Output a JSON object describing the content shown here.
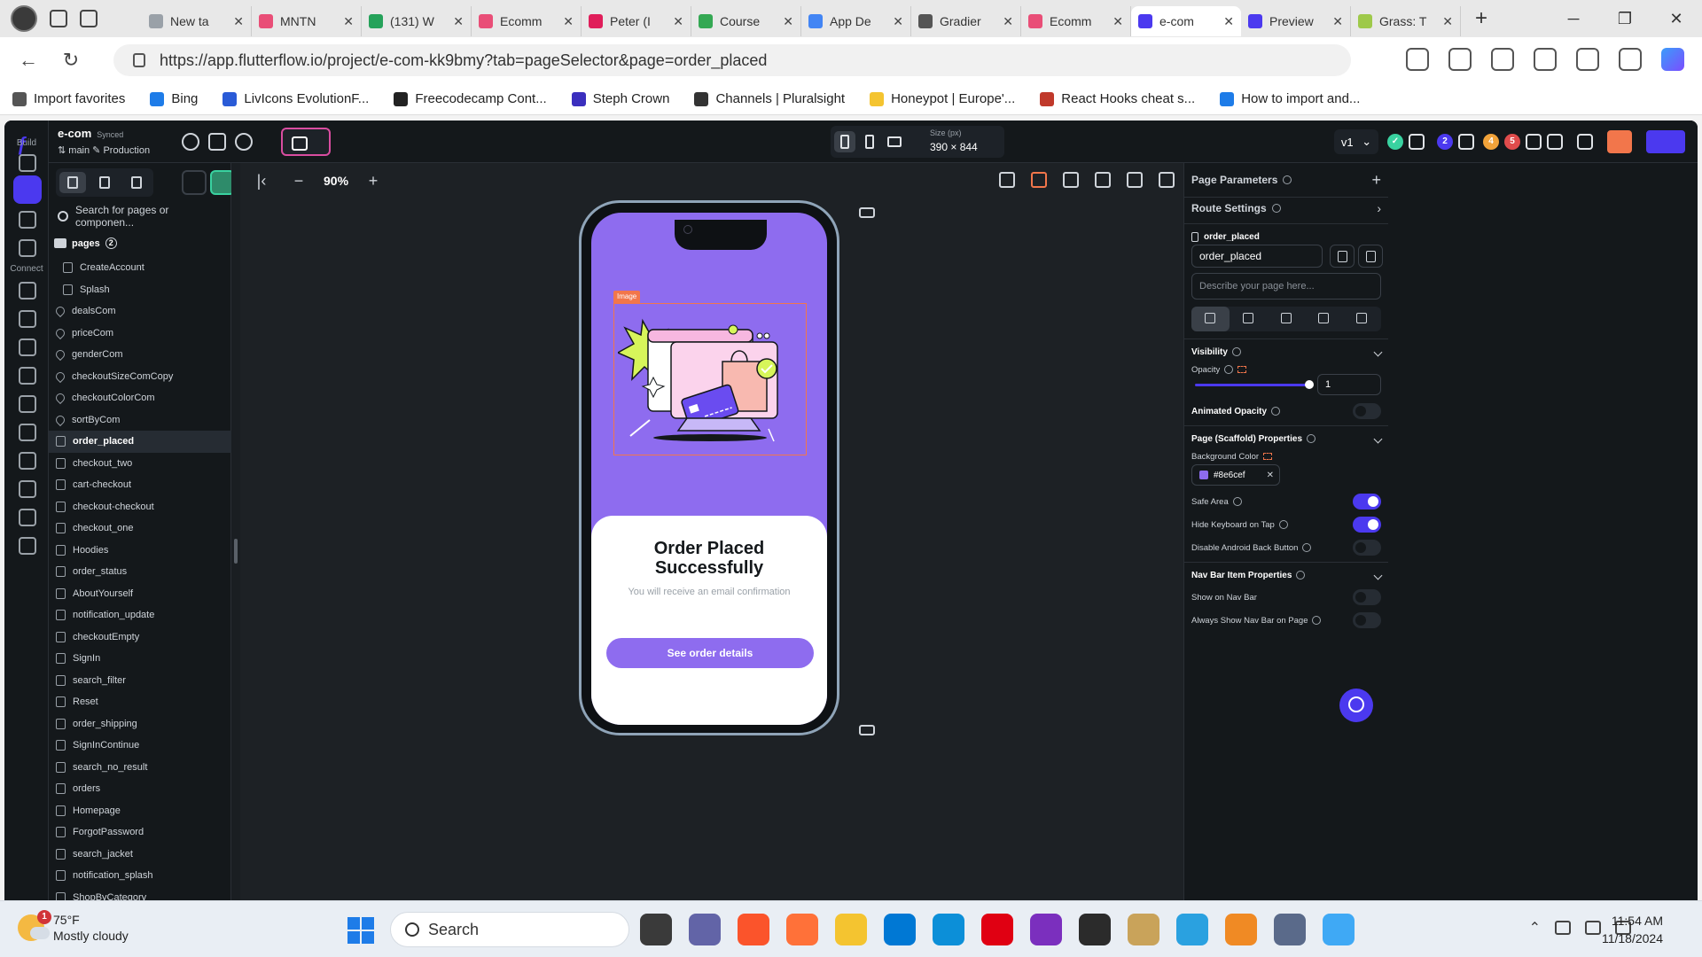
{
  "browser": {
    "tabs": [
      {
        "title": "New ta",
        "color": "#9aa1a8"
      },
      {
        "title": "MNTN",
        "color": "#e94e77"
      },
      {
        "title": "(131) W",
        "color": "#25a25a"
      },
      {
        "title": "Ecomm",
        "color": "#e94e77"
      },
      {
        "title": "Peter (I",
        "color": "#e01e5a"
      },
      {
        "title": "Course",
        "color": "#34a853"
      },
      {
        "title": "App De",
        "color": "#4285f4"
      },
      {
        "title": "Gradier",
        "color": "#555555"
      },
      {
        "title": "Ecomm",
        "color": "#e94e77"
      },
      {
        "title": "e-com",
        "color": "#4b39ef",
        "active": true
      },
      {
        "title": "Preview",
        "color": "#4b39ef"
      },
      {
        "title": "Grass: T",
        "color": "#9ec94a"
      }
    ],
    "url": "https://app.flutterflow.io/project/e-com-kk9bmy?tab=pageSelector&page=order_placed",
    "favorites": [
      "Import favorites",
      "Bing",
      "LivIcons EvolutionF...",
      "Freecodecamp Cont...",
      "Steph Crown",
      "Channels | Pluralsight",
      "Honeypot | Europe'...",
      "React Hooks cheat s...",
      "How to import and..."
    ]
  },
  "app": {
    "project_name": "e-com",
    "sync_status": "Synced",
    "branch": "main",
    "environment": "Production",
    "rail_sections": {
      "build": "Build",
      "connect": "Connect"
    },
    "device_size_label": "Size (px)",
    "device_size": "390 × 844",
    "version": "v1",
    "badge_counts": [
      "2",
      "4",
      "5"
    ],
    "zoom": "90%"
  },
  "pages": {
    "folder": "pages",
    "folder_count": "2",
    "items": [
      {
        "name": "CreateAccount",
        "icon": "page",
        "indent": true
      },
      {
        "name": "Splash",
        "icon": "page",
        "indent": true
      },
      {
        "name": "dealsCom",
        "icon": "component"
      },
      {
        "name": "priceCom",
        "icon": "component"
      },
      {
        "name": "genderCom",
        "icon": "component"
      },
      {
        "name": "checkoutSizeComCopy",
        "icon": "component"
      },
      {
        "name": "checkoutColorCom",
        "icon": "component"
      },
      {
        "name": "sortByCom",
        "icon": "component"
      },
      {
        "name": "order_placed",
        "icon": "page",
        "selected": true
      },
      {
        "name": "checkout_two",
        "icon": "page"
      },
      {
        "name": "cart-checkout",
        "icon": "page"
      },
      {
        "name": "checkout-checkout",
        "icon": "page"
      },
      {
        "name": "checkout_one",
        "icon": "page"
      },
      {
        "name": "Hoodies",
        "icon": "page"
      },
      {
        "name": "order_status",
        "icon": "page"
      },
      {
        "name": "AboutYourself",
        "icon": "page"
      },
      {
        "name": "notification_update",
        "icon": "page"
      },
      {
        "name": "checkoutEmpty",
        "icon": "page"
      },
      {
        "name": "SignIn",
        "icon": "page"
      },
      {
        "name": "search_filter",
        "icon": "page"
      },
      {
        "name": "Reset",
        "icon": "page"
      },
      {
        "name": "order_shipping",
        "icon": "page"
      },
      {
        "name": "SignInContinue",
        "icon": "page"
      },
      {
        "name": "search_no_result",
        "icon": "page"
      },
      {
        "name": "orders",
        "icon": "page"
      },
      {
        "name": "Homepage",
        "icon": "page"
      },
      {
        "name": "ForgotPassword",
        "icon": "page"
      },
      {
        "name": "search_jacket",
        "icon": "page"
      },
      {
        "name": "notification_splash",
        "icon": "page"
      },
      {
        "name": "ShopByCategory",
        "icon": "page"
      }
    ],
    "search_placeholder": "Search for pages or componen..."
  },
  "preview": {
    "image_tag": "Image",
    "title": "Order Placed Successfully",
    "subtitle": "You will receive an email confirmation",
    "button": "See order details",
    "bg_color": "#8e6cef"
  },
  "properties": {
    "page_parameters": "Page Parameters",
    "route_settings": "Route Settings",
    "page_name_label": "order_placed",
    "page_name_value": "order_placed",
    "description_placeholder": "Describe your page here...",
    "visibility": "Visibility",
    "opacity_label": "Opacity",
    "opacity_value": "1",
    "opacity_level": 1,
    "animated_opacity": "Animated Opacity",
    "scaffold_section": "Page (Scaffold) Properties",
    "background_color_label": "Background Color",
    "background_color_value": "#8e6cef",
    "safe_area": "Safe Area",
    "hide_keyboard": "Hide Keyboard on Tap",
    "disable_back": "Disable Android Back Button",
    "navbar_section": "Nav Bar Item Properties",
    "show_navbar": "Show on Nav Bar",
    "always_navbar": "Always Show Nav Bar on Page"
  },
  "taskbar": {
    "temperature": "75°F",
    "weather": "Mostly cloudy",
    "weather_badge": "1",
    "search": "Search",
    "time": "11:54 AM",
    "date": "11/18/2024"
  }
}
